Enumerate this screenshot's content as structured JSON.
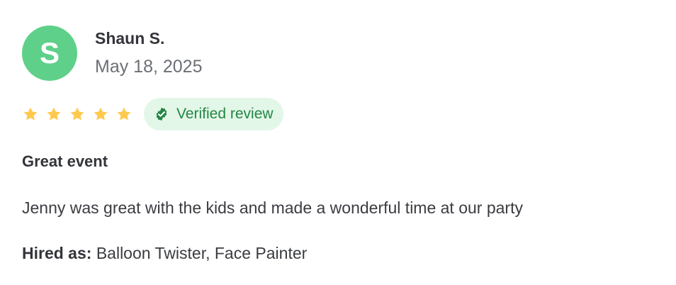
{
  "reviewer": {
    "initial": "S",
    "name": "Shaun S.",
    "date": "May 18, 2025",
    "avatar_color": "#5FD08A"
  },
  "rating": {
    "value": 5,
    "max": 5,
    "star_icon": "star-icon",
    "star_color": "#FFC94D"
  },
  "verified": {
    "label": "Verified review",
    "icon": "verified-check-icon",
    "badge_bg": "#E3F7E8",
    "text_color": "#238644"
  },
  "review": {
    "title": "Great event",
    "body": "Jenny was great with the kids and made a wonderful time at our party"
  },
  "hired_as": {
    "label": "Hired as:",
    "value": "Balloon Twister, Face Painter"
  }
}
